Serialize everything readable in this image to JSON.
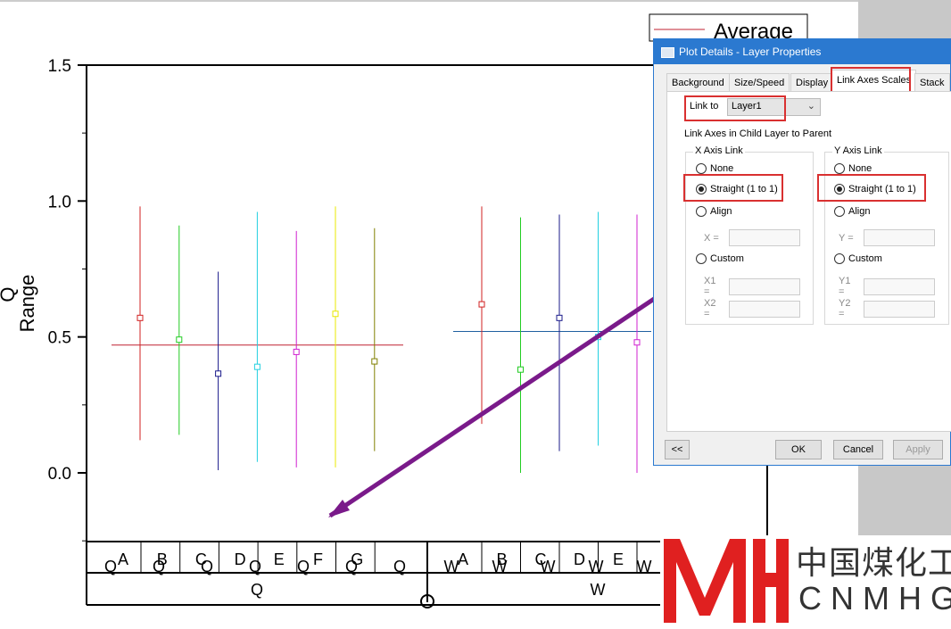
{
  "graph": {
    "y_axis_title_1": "Q",
    "y_axis_title_2": "Range",
    "legend_label": "Average",
    "y_ticks": [
      "1.5",
      "1.0",
      "0.5",
      "0.0"
    ],
    "x_labels_q": [
      "A",
      "B",
      "C",
      "D",
      "E",
      "F",
      "G"
    ],
    "x_labels_w": [
      "A",
      "B",
      "C",
      "D",
      "E"
    ],
    "sub_label_q": "Q",
    "sub_label_w": "W",
    "group_q": "Q",
    "group_w": "W"
  },
  "chart_data": {
    "type": "scatter",
    "ylabel": "Q Range",
    "ylim": [
      -0.25,
      1.5
    ],
    "groups": [
      {
        "name": "Q",
        "average": 0.47,
        "points": [
          {
            "cat": "A",
            "y": 0.57,
            "low": 0.12,
            "high": 0.98,
            "color": "#d02020"
          },
          {
            "cat": "B",
            "y": 0.49,
            "low": 0.14,
            "high": 0.91,
            "color": "#22cc22"
          },
          {
            "cat": "C",
            "y": 0.365,
            "low": 0.01,
            "high": 0.74,
            "color": "#1a1a8a"
          },
          {
            "cat": "D",
            "y": 0.39,
            "low": 0.04,
            "high": 0.96,
            "color": "#22d0e0"
          },
          {
            "cat": "E",
            "y": 0.445,
            "low": 0.02,
            "high": 0.89,
            "color": "#d020d0"
          },
          {
            "cat": "F",
            "y": 0.585,
            "low": 0.02,
            "high": 0.98,
            "color": "#e8e800"
          },
          {
            "cat": "G",
            "y": 0.41,
            "low": 0.08,
            "high": 0.9,
            "color": "#808000"
          }
        ]
      },
      {
        "name": "W",
        "average": 0.52,
        "points": [
          {
            "cat": "A",
            "y": 0.62,
            "low": 0.18,
            "high": 0.98,
            "color": "#d02020"
          },
          {
            "cat": "B",
            "y": 0.38,
            "low": 0.0,
            "high": 0.94,
            "color": "#22cc22"
          },
          {
            "cat": "C",
            "y": 0.57,
            "low": 0.08,
            "high": 0.95,
            "color": "#1a1a8a"
          },
          {
            "cat": "D",
            "y": 0.5,
            "low": 0.1,
            "high": 0.96,
            "color": "#22d0e0"
          },
          {
            "cat": "E",
            "y": 0.48,
            "low": 0.0,
            "high": 0.95,
            "color": "#d020d0"
          }
        ]
      }
    ]
  },
  "dialog": {
    "title": "Plot Details - Layer Properties",
    "tabs": [
      "Background",
      "Size/Speed",
      "Display",
      "Link Axes Scales",
      "Stack"
    ],
    "link_to_label": "Link to",
    "link_to_value": "Layer1",
    "section_label": "Link Axes in Child Layer to Parent",
    "x_group": "X Axis Link",
    "y_group": "Y Axis Link",
    "options": [
      "None",
      "Straight (1 to 1)",
      "Align",
      "Custom"
    ],
    "x_fields": [
      "X =",
      "X1 =",
      "X2 ="
    ],
    "y_fields": [
      "Y =",
      "Y1 =",
      "Y2 ="
    ],
    "buttons": {
      "collapse": "<<",
      "ok": "OK",
      "cancel": "Cancel",
      "apply": "Apply"
    }
  },
  "watermark": {
    "cn": "中国煤化工",
    "en": "CNMHG"
  }
}
